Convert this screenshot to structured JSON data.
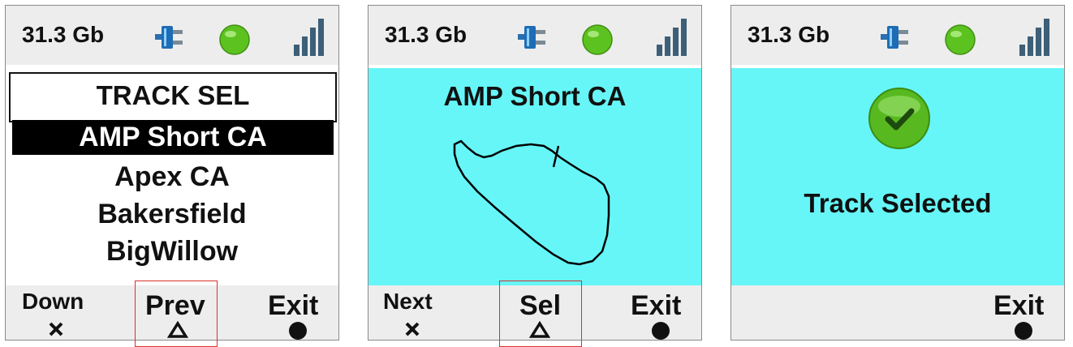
{
  "status": {
    "storage": "31.3 Gb"
  },
  "icons": {
    "power": "plug-icon",
    "gps": "green-status-led-icon",
    "signal": "signal-bars-icon",
    "check": "checkmark-icon",
    "cross": "cross-symbol-icon",
    "triangle": "triangle-symbol-icon",
    "circle": "circle-symbol-icon"
  },
  "colors": {
    "highlight": "#66f6f8",
    "bar_bg": "#ededed",
    "led": "#5cc21f",
    "accent_box": "#d9302a"
  },
  "screen1": {
    "title": "TRACK SEL",
    "tracks": [
      "AMP Short CA",
      "Apex CA",
      "Bakersfield",
      "BigWillow"
    ],
    "softkeys": {
      "left": "Down",
      "center": "Prev",
      "right": "Exit"
    }
  },
  "screen2": {
    "track_name": "AMP Short CA",
    "softkeys": {
      "left": "Next",
      "center": "Sel",
      "right": "Exit"
    }
  },
  "screen3": {
    "message": "Track Selected",
    "softkeys": {
      "right": "Exit"
    }
  }
}
